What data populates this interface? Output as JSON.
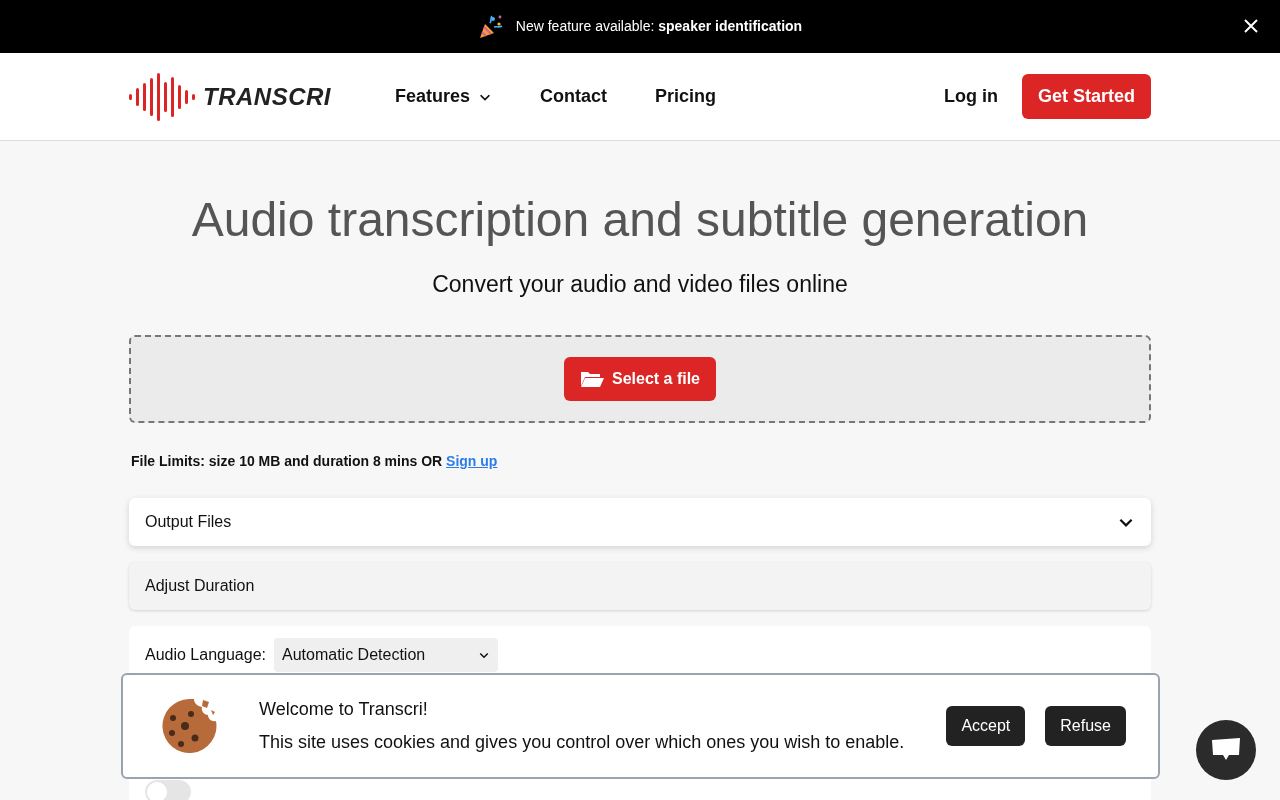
{
  "announcement": {
    "text": "New feature available: **speaker identification**"
  },
  "nav": {
    "brand": "TRANSCRI",
    "links": [
      {
        "label": "Features",
        "dropdown": true
      },
      {
        "label": "Contact",
        "dropdown": false
      },
      {
        "label": "Pricing",
        "dropdown": false
      }
    ],
    "login": "Log in",
    "cta": "Get Started"
  },
  "hero": {
    "title": "Audio transcription and subtitle generation",
    "subtitle": "Convert your audio and video files online"
  },
  "upload": {
    "button": "Select a file",
    "limits": "File Limits: size 10 MB and duration 8 mins OR",
    "signup": "Sign up"
  },
  "sections": [
    {
      "label": "Output Files",
      "expanded": false
    },
    {
      "label": "Adjust Duration"
    }
  ],
  "options": {
    "language_label": "Audio Language:",
    "language_value": "Automatic Detection",
    "translation": {
      "on": false
    }
  },
  "cookie_banner": {
    "title": "Welcome to Transcri!",
    "text": "This site uses cookies and gives you control over which ones you wish to enable.",
    "buttons": [
      "Accept",
      "Refuse"
    ]
  }
}
